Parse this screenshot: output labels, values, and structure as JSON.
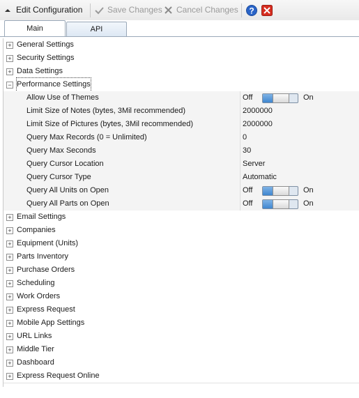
{
  "toolbar": {
    "edit_label": "Edit Configuration",
    "save_label": "Save Changes",
    "cancel_label": "Cancel Changes"
  },
  "tabs": [
    {
      "label": "Main",
      "active": true
    },
    {
      "label": "API",
      "active": false
    }
  ],
  "categories": {
    "general": "General Settings",
    "security": "Security Settings",
    "data": "Data Settings",
    "performance": "Performance Settings",
    "email": "Email Settings",
    "companies": "Companies",
    "equipment": "Equipment (Units)",
    "parts": "Parts Inventory",
    "purchase": "Purchase Orders",
    "scheduling": "Scheduling",
    "workorders": "Work Orders",
    "express": "Express Request",
    "mobile": "Mobile App Settings",
    "url": "URL Links",
    "middle": "Middle Tier",
    "dashboard": "Dashboard",
    "express_online": "Express Request Online"
  },
  "performance": {
    "themes": {
      "label": "Allow Use of Themes",
      "off": "Off",
      "on": "On",
      "state": 0.55
    },
    "notes_limit": {
      "label": "Limit Size of Notes (bytes, 3Mil recommended)",
      "value": "2000000"
    },
    "pictures_limit": {
      "label": "Limit Size of Pictures (bytes, 3Mil recommended)",
      "value": "2000000"
    },
    "max_records": {
      "label": "Query Max Records (0 = Unlimited)",
      "value": "0"
    },
    "max_seconds": {
      "label": "Query Max Seconds",
      "value": "30"
    },
    "cursor_location": {
      "label": "Query Cursor Location",
      "value": "Server"
    },
    "cursor_type": {
      "label": "Query Cursor Type",
      "value": "Automatic"
    },
    "units_on_open": {
      "label": "Query All Units on Open",
      "off": "Off",
      "on": "On",
      "state": 0.55
    },
    "parts_on_open": {
      "label": "Query All Parts on Open",
      "off": "Off",
      "on": "On",
      "state": 0.55
    }
  },
  "colors": {
    "accent_blue": "#3f86cf",
    "cancel_red": "#d62d20",
    "help_blue": "#2a64c8"
  },
  "icons": [
    "collapse-arrow-icon",
    "checkmark-icon",
    "x-icon",
    "help-icon",
    "close-icon"
  ]
}
